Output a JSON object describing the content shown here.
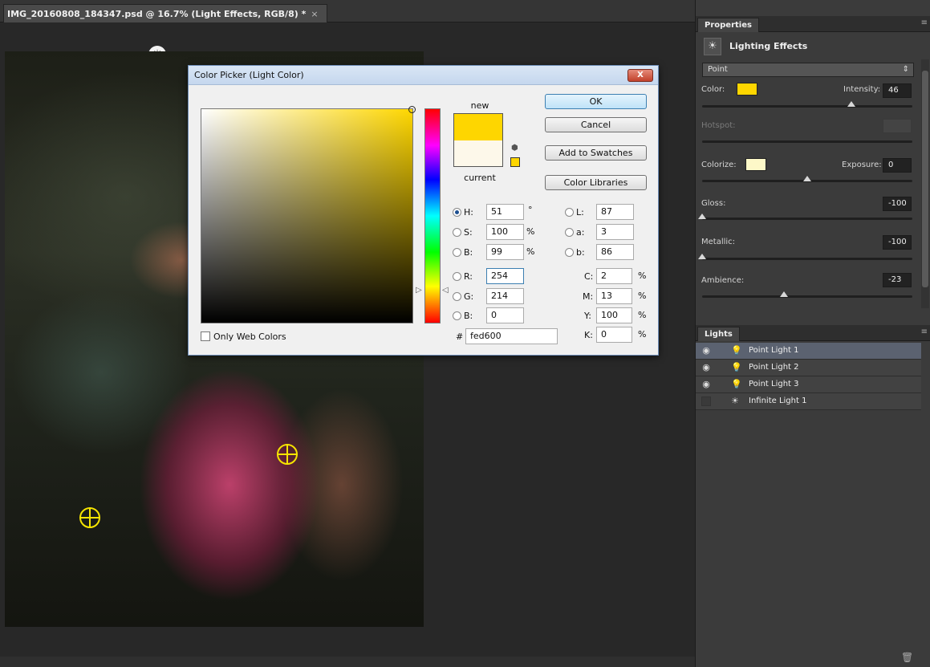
{
  "document": {
    "tab_title": "IMG_20160808_184347.psd @ 16.7% (Light Effects, RGB/8) *",
    "tab_close": "×"
  },
  "properties_panel": {
    "tab_label": "Properties",
    "header_label": "Lighting Effects",
    "light_type": "Point",
    "color_label": "Color:",
    "color_swatch": "#fed600",
    "intensity_label": "Intensity:",
    "intensity_value": "46",
    "intensity_pct": 0.71,
    "hotspot_label": "Hotspot:",
    "colorize_label": "Colorize:",
    "colorize_swatch": "#fdf8c8",
    "exposure_label": "Exposure:",
    "exposure_value": "0",
    "exposure_pct": 0.5,
    "gloss_label": "Gloss:",
    "gloss_value": "-100",
    "gloss_pct": 0.0,
    "metallic_label": "Metallic:",
    "metallic_value": "-100",
    "metallic_pct": 0.0,
    "ambience_label": "Ambience:",
    "ambience_value": "-23",
    "ambience_pct": 0.39
  },
  "lights_panel": {
    "tab_label": "Lights",
    "items": [
      {
        "name": "Point Light 1",
        "visible": true,
        "selected": true
      },
      {
        "name": "Point Light 2",
        "visible": true,
        "selected": false
      },
      {
        "name": "Point Light 3",
        "visible": true,
        "selected": false
      },
      {
        "name": "Infinite Light 1",
        "visible": false,
        "selected": false
      }
    ]
  },
  "color_picker": {
    "title": "Color Picker (Light Color)",
    "close_label": "X",
    "new_label": "new",
    "current_label": "current",
    "new_color": "#fed600",
    "current_color": "#fdf8ea",
    "ok_label": "OK",
    "cancel_label": "Cancel",
    "add_swatches_label": "Add to Swatches",
    "color_libraries_label": "Color Libraries",
    "only_web_colors_label": "Only Web Colors",
    "fields": {
      "H": {
        "label": "H:",
        "value": "51",
        "unit": "°",
        "selected": true
      },
      "S": {
        "label": "S:",
        "value": "100",
        "unit": "%"
      },
      "Bv": {
        "label": "B:",
        "value": "99",
        "unit": "%"
      },
      "R": {
        "label": "R:",
        "value": "254"
      },
      "G": {
        "label": "G:",
        "value": "214"
      },
      "Bc": {
        "label": "B:",
        "value": "0"
      },
      "L": {
        "label": "L:",
        "value": "87"
      },
      "a": {
        "label": "a:",
        "value": "3"
      },
      "b": {
        "label": "b:",
        "value": "86"
      },
      "C": {
        "label": "C:",
        "value": "2",
        "unit": "%"
      },
      "M": {
        "label": "M:",
        "value": "13",
        "unit": "%"
      },
      "Y": {
        "label": "Y:",
        "value": "100",
        "unit": "%"
      },
      "K": {
        "label": "K:",
        "value": "0",
        "unit": "%"
      }
    },
    "hash_label": "#",
    "hex_value": "fed600"
  },
  "icons": {
    "bulb": "light-bulb-icon",
    "lighting_effects": "lighting-effects-icon",
    "eye": "eye-icon",
    "trash": "trash-icon",
    "cube": "cube-icon"
  }
}
